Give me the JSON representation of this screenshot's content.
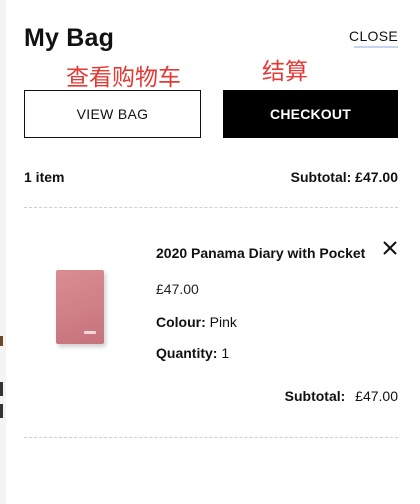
{
  "bag": {
    "title": "My Bag",
    "close_label": "CLOSE",
    "annotations": {
      "view_bag_note": "查看购物车",
      "checkout_note": "结算"
    },
    "buttons": {
      "view_bag": "VIEW BAG",
      "checkout": "CHECKOUT"
    },
    "summary": {
      "item_count": "1 item",
      "subtotal": "Subtotal: £47.00"
    },
    "items": [
      {
        "name": "2020 Panama Diary with Pocket",
        "price": "£47.00",
        "colour_label": "Colour:",
        "colour_value": "Pink",
        "quantity_label": "Quantity:",
        "quantity_value": "1",
        "subtotal_label": "Subtotal:",
        "subtotal_value": "£47.00",
        "remove_icon": "close-x-icon"
      }
    ]
  }
}
